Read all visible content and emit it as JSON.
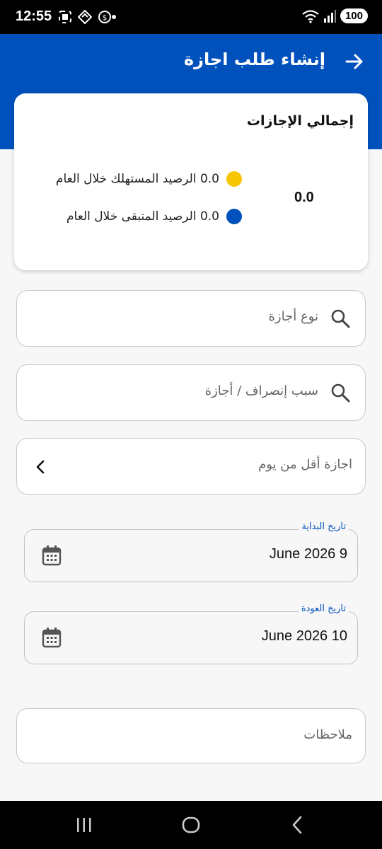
{
  "status_bar": {
    "time": "12:55",
    "battery": "100",
    "icons": [
      "screenshot-icon",
      "location-icon",
      "data-saver-icon",
      "wifi-icon",
      "signal-icon"
    ]
  },
  "header": {
    "title": "إنشاء طلب اجازة",
    "back_icon": "arrow-right-icon",
    "color": "#0151bd"
  },
  "summary": {
    "title": "إجمالي الإجازات",
    "total": "0.0",
    "legend": [
      {
        "value_text": "0.0 الرصيد المستهلك خلال العام",
        "color": "#f7c600"
      },
      {
        "value_text": "0.0 الرصيد المتبقى خلال العام",
        "color": "#0151bd"
      }
    ]
  },
  "form": {
    "leave_type_placeholder": "نوع أجازة",
    "reason_placeholder": "سبب إنصراف / أجازة",
    "less_than_day_label": "اجازة أقل من يوم",
    "start_date": {
      "label": "تاريخ البداية",
      "value": "June 2026 9"
    },
    "return_date": {
      "label": "تاريخ العودة",
      "value": "June 2026 10"
    },
    "notes_placeholder": "ملاحظات"
  },
  "nav_bar": {
    "icons": [
      "recent-apps-icon",
      "home-icon",
      "back-icon"
    ]
  }
}
